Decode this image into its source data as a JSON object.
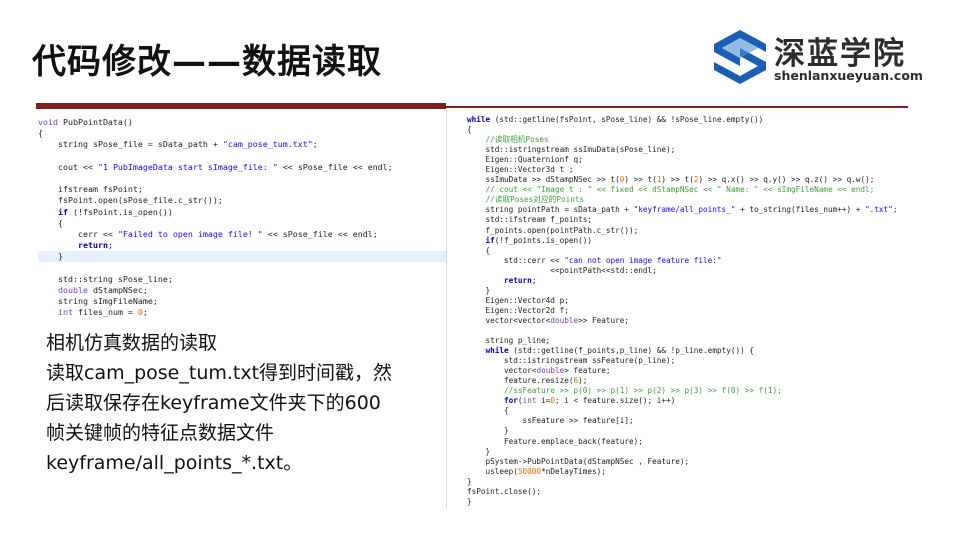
{
  "title": "代码修改——数据读取",
  "logo": {
    "cn": "深蓝学院",
    "en": "shenlanxueyuan.com",
    "colors": {
      "blue": "#1a5fb4",
      "dark": "#2d2d2d"
    }
  },
  "left_code": [
    "void PubPointData()",
    "{",
    "    string sPose_file = sData_path + \"cam_pose_tum.txt\";",
    "",
    "    cout << \"1 PubImageData start sImage_file: \" << sPose_file << endl;",
    "",
    "    ifstream fsPoint;",
    "    fsPoint.open(sPose_file.c_str());",
    "    if (!fsPoint.is_open())",
    "    {",
    "        cerr << \"Failed to open image file! \" << sPose_file << endl;",
    "        return;",
    "    }",
    "",
    "    std::string sPose_line;",
    "    double dStampNSec;",
    "    string sImgFileName;",
    "    int files_num = 0;"
  ],
  "description": [
    "相机仿真数据的读取",
    "读取cam_pose_tum.txt得到时间戳，然",
    "后读取保存在keyframe文件夹下的600",
    "帧关键帧的特征点数据文件",
    "keyframe/all_points_*.txt。"
  ],
  "right_code": [
    "while (std::getline(fsPoint, sPose_line) && !sPose_line.empty())",
    "{",
    "    //读取相机Poses",
    "    std::istringstream ssImuData(sPose_line);",
    "    Eigen::Quaternionf q;",
    "    Eigen::Vector3d t ;",
    "    ssImuData >> dStampNSec >> t(0) >> t(1) >> t(2) >> q.x() >> q.y() >> q.z() >> q.w();",
    "    // cout << \"Image t : \" << fixed << dStampNSec << \" Name: \" << sImgFileName << endl;",
    "    //读取Poses对应的Points",
    "    string pointPath = sData_path + \"keyframe/all_points_\" + to_string(files_num++) + \".txt\";",
    "    std::ifstream f_points;",
    "    f_points.open(pointPath.c_str());",
    "    if(!f_points.is_open())",
    "    {",
    "        std::cerr << \"can not open image feature file:\"",
    "                  <<pointPath<<std::endl;",
    "        return;",
    "    }",
    "    Eigen::Vector4d p;",
    "    Eigen::Vector2d f;",
    "    vector<vector<double>> Feature;",
    "",
    "    string p_line;",
    "    while (std::getline(f_points,p_line) && !p_line.empty()) {",
    "        std::istringstream ssFeature(p_line);",
    "        vector<double> feature;",
    "        feature.resize(6);",
    "        //ssFeature >> p(0) >> p(1) >> p(2) >> p(3) >> f(0) >> f(1);",
    "        for(int i=0; i < feature.size(); i++)",
    "        {",
    "            ssFeature >> feature[i];",
    "        }",
    "        Feature.emplace_back(feature);",
    "    }",
    "    pSystem->PubPointData(dStampNSec , Feature);",
    "    usleep(50000*nDelayTimes);",
    "}",
    "fsPoint.close();",
    "}"
  ]
}
